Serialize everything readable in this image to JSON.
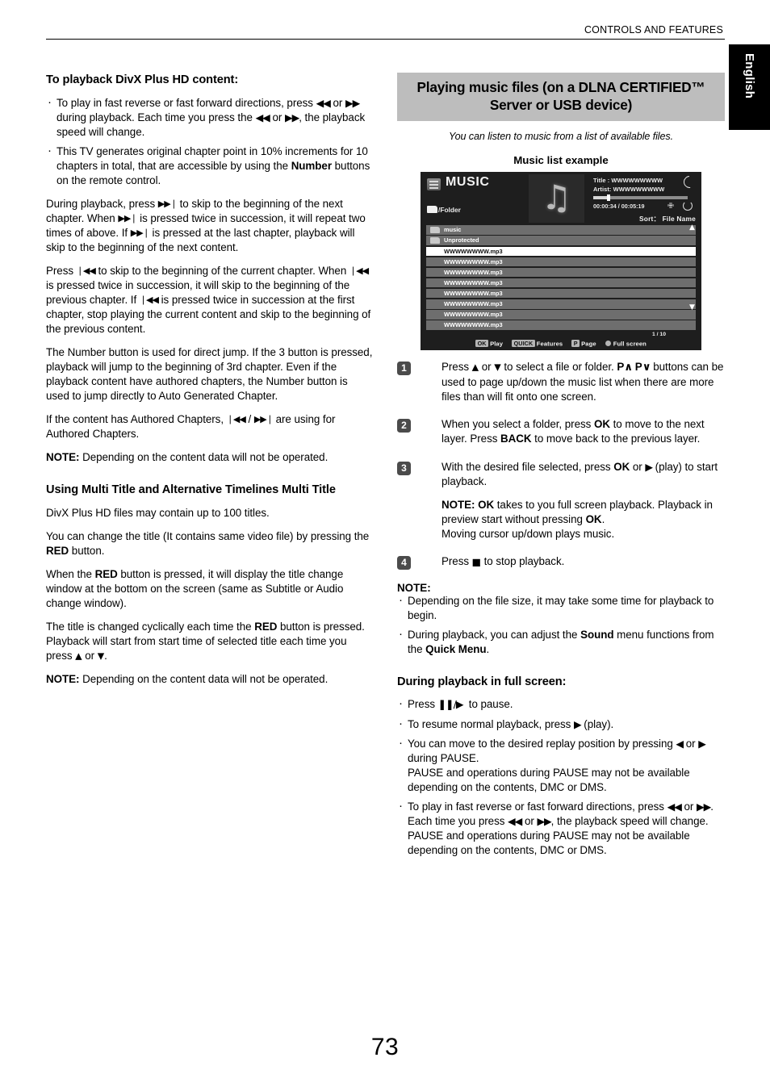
{
  "header": {
    "running_title": "CONTROLS AND FEATURES",
    "language_tab": "English"
  },
  "page_number": "73",
  "left_column": {
    "heading_1": "To playback DivX Plus HD content:",
    "bullets": [
      "To play in fast reverse or fast forward directions, press ◀◀ or ▶▶ during playback. Each time you press the ◀◀ or ▶▶, the playback speed will change.",
      "This TV generates original chapter point in 10% increments for 10 chapters in total, that are accessible by using the Number buttons on the remote control."
    ],
    "bullet2_bold": "Number",
    "para_1": "During playback, press ▶▶| to skip to the beginning of the next chapter. When ▶▶| is pressed twice in succession, it will repeat two times of above. If ▶▶| is pressed at the last chapter, playback will skip to the beginning of the next content.",
    "para_2": "Press |◀◀ to skip to the beginning of the current chapter. When |◀◀ is pressed twice in succession, it will skip to the beginning of the previous chapter. If |◀◀ is pressed twice in succession at the first chapter, stop playing the current content and skip to the beginning of the previous content.",
    "para_3": "The Number button is used for direct jump. If the 3 button is pressed, playback will jump to the beginning of 3rd chapter. Even if the playback content have authored chapters, the Number button is used to jump directly to Auto Generated Chapter.",
    "para_4": "If the content has Authored Chapters, |◀◀ / ▶▶| are using for Authored Chapters.",
    "note_1_label": "NOTE:",
    "note_1_text": " Depending on the content data will not be operated.",
    "heading_2": "Using Multi Title and Alternative Timelines Multi Title",
    "para_5": "DivX Plus HD files may contain up to 100 titles.",
    "para_6": "You can change the title (It contains same video file) by pressing the RED button.",
    "para_7": "When the RED button is pressed, it will display the title change window at the bottom on the screen (same as Subtitle or Audio change window).",
    "para_8": "The title is changed cyclically each time the RED button is pressed. Playback will start from start time of selected title each time you press ▲ or ▼.",
    "note_2_label": "NOTE:",
    "note_2_text": " Depending on the content data will not be operated."
  },
  "right_column": {
    "banner_title": "Playing music files (on a DLNA CERTIFIED™ Server or USB device)",
    "intro_italic": "You can listen to music from a list of available files.",
    "figure_caption": "Music list example",
    "note_heading": "NOTE:",
    "note_bullets": [
      "Depending on the file size, it may take some time for playback to begin.",
      "During playback, you can adjust the Sound menu functions from the Quick Menu."
    ],
    "fullscreen_heading": "During playback in full screen:",
    "fullscreen_bullets": [
      "Press ▐▐/▶ to pause.",
      "To resume normal playback, press ▶ (play).",
      "You can move to the desired replay position by pressing ◀ or ▶ during PAUSE. PAUSE and operations during PAUSE may not be available depending on the contents, DMC or DMS.",
      "To play in fast reverse or fast forward directions, press ◀◀ or ▶▶. Each time you press ◀◀ or ▶▶, the playback speed will change. PAUSE and operations during PAUSE may not be available depending on the contents, DMC or DMS."
    ]
  },
  "steps": [
    {
      "number": "1",
      "text": "Press ▲ or ▼ to select a file or folder. P∧ P∨ buttons can be used to page up/down the music list when there are more files than will fit onto one screen."
    },
    {
      "number": "2",
      "text": "When you select a folder, press OK to move to the next layer. Press BACK to move back to the previous layer."
    },
    {
      "number": "3",
      "text": "With the desired file selected, press OK or ▶ (play) to start playback.",
      "note_label": "NOTE: OK",
      "note_text": " takes to you full screen playback. Playback in preview start without pressing OK. Moving cursor up/down plays music."
    },
    {
      "number": "4",
      "text": "Press ■ to stop playback."
    }
  ],
  "tv_screen": {
    "app_title": "MUSIC",
    "folder_path": "/Folder",
    "track_title": "Title : WWWWWWWWW",
    "track_artist": "Artist: WWWWWWWWW",
    "elapsed_total": "00:00:34 / 00:05:19",
    "sort_label": "Sort： File Name",
    "progress_percent": 16,
    "list_items": [
      {
        "label": "music",
        "type": "folder",
        "selected": false
      },
      {
        "label": "Unprotected",
        "type": "folder",
        "selected": false
      },
      {
        "label": "WWWWWWWW.mp3",
        "type": "file",
        "selected": true
      },
      {
        "label": "WWWWWWWW.mp3",
        "type": "file",
        "selected": false
      },
      {
        "label": "WWWWWWWW.mp3",
        "type": "file",
        "selected": false
      },
      {
        "label": "WWWWWWWW.mp3",
        "type": "file",
        "selected": false
      },
      {
        "label": "WWWWWWWW.mp3",
        "type": "file",
        "selected": false
      },
      {
        "label": "WWWWWWWW.mp3",
        "type": "file",
        "selected": false
      },
      {
        "label": "WWWWWWWW.mp3",
        "type": "file",
        "selected": false
      },
      {
        "label": "WWWWWWWW.mp3",
        "type": "file",
        "selected": false
      }
    ],
    "page_indicator": "1 / 10",
    "footer": {
      "ok_key": "OK",
      "ok_label": "Play",
      "quick_key": "QUICK",
      "quick_label": "Features",
      "p_key": "P",
      "p_label": "Page",
      "dot_label": "Full screen"
    },
    "colors": {
      "background": "#1e1e1e",
      "row": "#6e6e6e",
      "row_selected": "#ffffff"
    }
  }
}
